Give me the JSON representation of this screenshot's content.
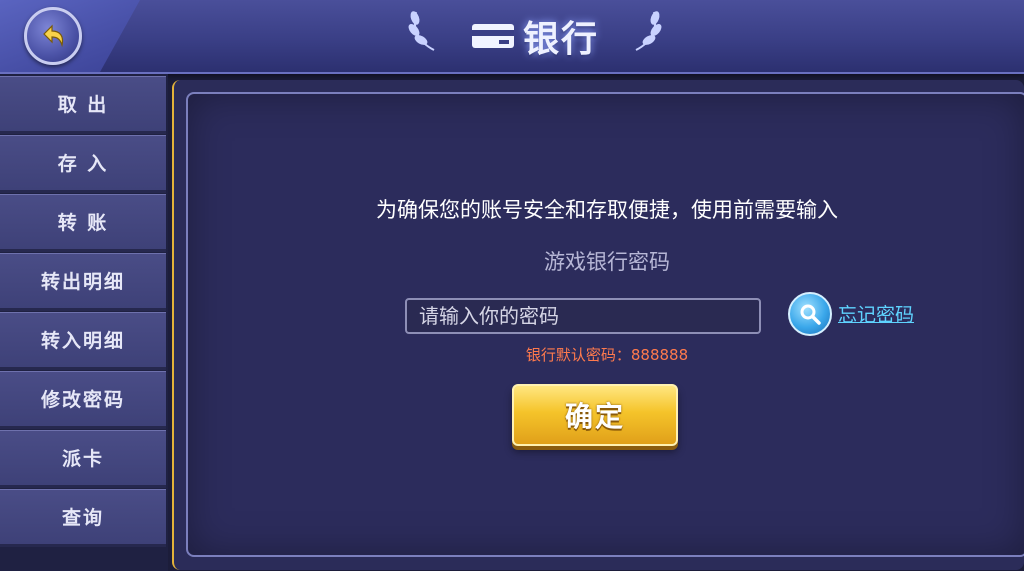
{
  "header": {
    "title": "银行",
    "back_icon": "back-arrow-icon",
    "title_icon": "bank-card-icon"
  },
  "sidebar": {
    "items": [
      {
        "label": "取 出"
      },
      {
        "label": "存 入"
      },
      {
        "label": "转 账"
      },
      {
        "label": "转出明细"
      },
      {
        "label": "转入明细"
      },
      {
        "label": "修改密码"
      },
      {
        "label": "派卡"
      },
      {
        "label": "查询"
      }
    ]
  },
  "main": {
    "message_line1": "为确保您的账号安全和存取便捷，使用前需要输入",
    "message_line2": "游戏银行密码",
    "password_placeholder": "请输入你的密码",
    "forgot_link": "忘记密码",
    "default_password_hint": "银行默认密码：888888",
    "confirm_label": "确定"
  },
  "colors": {
    "accent_gold": "#f5c42a",
    "link_cyan": "#5fd4ff",
    "hint_orange": "#ff7a4d"
  }
}
